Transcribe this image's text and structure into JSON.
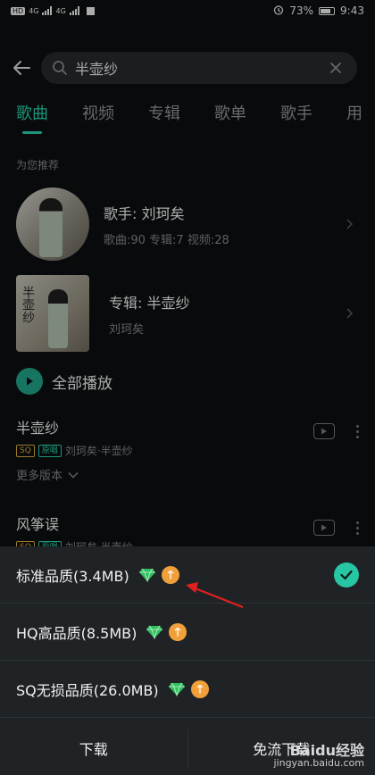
{
  "status_bar": {
    "left_chips": [
      "HD",
      "4G",
      "4G"
    ],
    "battery": "73%",
    "time": "9:43"
  },
  "search": {
    "query": "半壶纱"
  },
  "tabs": [
    {
      "label": "歌曲",
      "active": true
    },
    {
      "label": "视频",
      "active": false
    },
    {
      "label": "专辑",
      "active": false
    },
    {
      "label": "歌单",
      "active": false
    },
    {
      "label": "歌手",
      "active": false
    },
    {
      "label": "用",
      "active": false
    }
  ],
  "recommend": {
    "label": "为您推荐",
    "artist": {
      "title": "歌手: 刘珂矣",
      "sub": "歌曲:90 专辑:7 视频:28"
    },
    "album": {
      "title": "专辑: 半壶纱",
      "sub": "刘珂矣",
      "cover_text": "半壶纱"
    }
  },
  "play_all": "全部播放",
  "songs": [
    {
      "title": "半壶纱",
      "badges": [
        "SQ",
        "原唱"
      ],
      "meta": "刘珂矣·半壶纱"
    },
    {
      "title": "风筝误",
      "badges": [
        "SQ",
        "原唱"
      ],
      "meta": "刘珂矣·半壶纱"
    }
  ],
  "more_versions": "更多版本",
  "quality_sheet": {
    "options": [
      {
        "label": "标准品质(3.4MB)",
        "selected": true
      },
      {
        "label": "HQ高品质(8.5MB)",
        "selected": false
      },
      {
        "label": "SQ无损品质(26.0MB)",
        "selected": false
      }
    ],
    "download": "下载",
    "free_flow": "免流下载"
  },
  "watermark": {
    "logo": "Baidu经验",
    "url": "jingyan.baidu.com"
  },
  "colors": {
    "accent": "#27c7a3",
    "background": "#0b0e0f",
    "sheet": "#1f2326",
    "annotation_arrow": "#e0201f"
  }
}
